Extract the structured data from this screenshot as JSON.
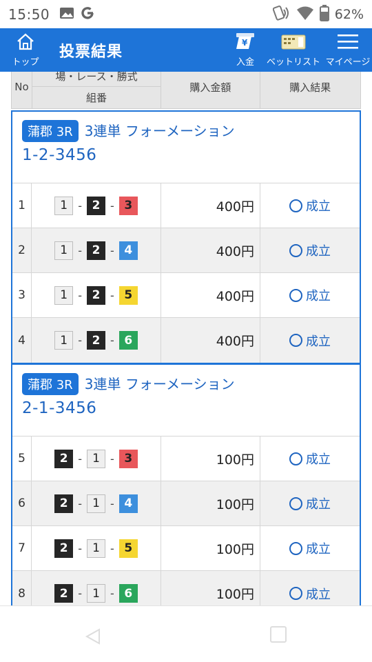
{
  "status_bar": {
    "time": "15:50",
    "left_icons": [
      "image-icon",
      "g-icon"
    ],
    "right_icons": [
      "nfc-icon",
      "wifi-icon",
      "battery-icon"
    ],
    "battery": "62%"
  },
  "header": {
    "home_label": "トップ",
    "title": "投票結果",
    "deposit_label": "入金",
    "betlist_label": "ベットリスト",
    "mypage_label": "マイページ",
    "accent": "#1e74d8"
  },
  "table_header": {
    "no": "No",
    "field_top": "場・レース・勝式",
    "field_bottom": "組番",
    "amount": "購入金額",
    "result": "購入結果"
  },
  "groups": [
    {
      "venue": "蒲郡 3R",
      "bet_type": "3連単 フォーメーション",
      "combo": "1-2-3456",
      "rows": [
        {
          "no": "1",
          "boats": [
            "1",
            "2",
            "3"
          ],
          "amount": "400円",
          "result": "成立"
        },
        {
          "no": "2",
          "boats": [
            "1",
            "2",
            "4"
          ],
          "amount": "400円",
          "result": "成立"
        },
        {
          "no": "3",
          "boats": [
            "1",
            "2",
            "5"
          ],
          "amount": "400円",
          "result": "成立"
        },
        {
          "no": "4",
          "boats": [
            "1",
            "2",
            "6"
          ],
          "amount": "400円",
          "result": "成立"
        }
      ]
    },
    {
      "venue": "蒲郡 3R",
      "bet_type": "3連単 フォーメーション",
      "combo": "2-1-3456",
      "rows": [
        {
          "no": "5",
          "boats": [
            "2",
            "1",
            "3"
          ],
          "amount": "100円",
          "result": "成立"
        },
        {
          "no": "6",
          "boats": [
            "2",
            "1",
            "4"
          ],
          "amount": "100円",
          "result": "成立"
        },
        {
          "no": "7",
          "boats": [
            "2",
            "1",
            "5"
          ],
          "amount": "100円",
          "result": "成立"
        },
        {
          "no": "8",
          "boats": [
            "2",
            "1",
            "6"
          ],
          "amount": "100円",
          "result": "成立"
        }
      ]
    }
  ],
  "boat_colors": {
    "1": "#efefef",
    "2": "#262626",
    "3": "#e8575b",
    "4": "#3d8fdd",
    "5": "#f5d631",
    "6": "#2aa65c"
  }
}
